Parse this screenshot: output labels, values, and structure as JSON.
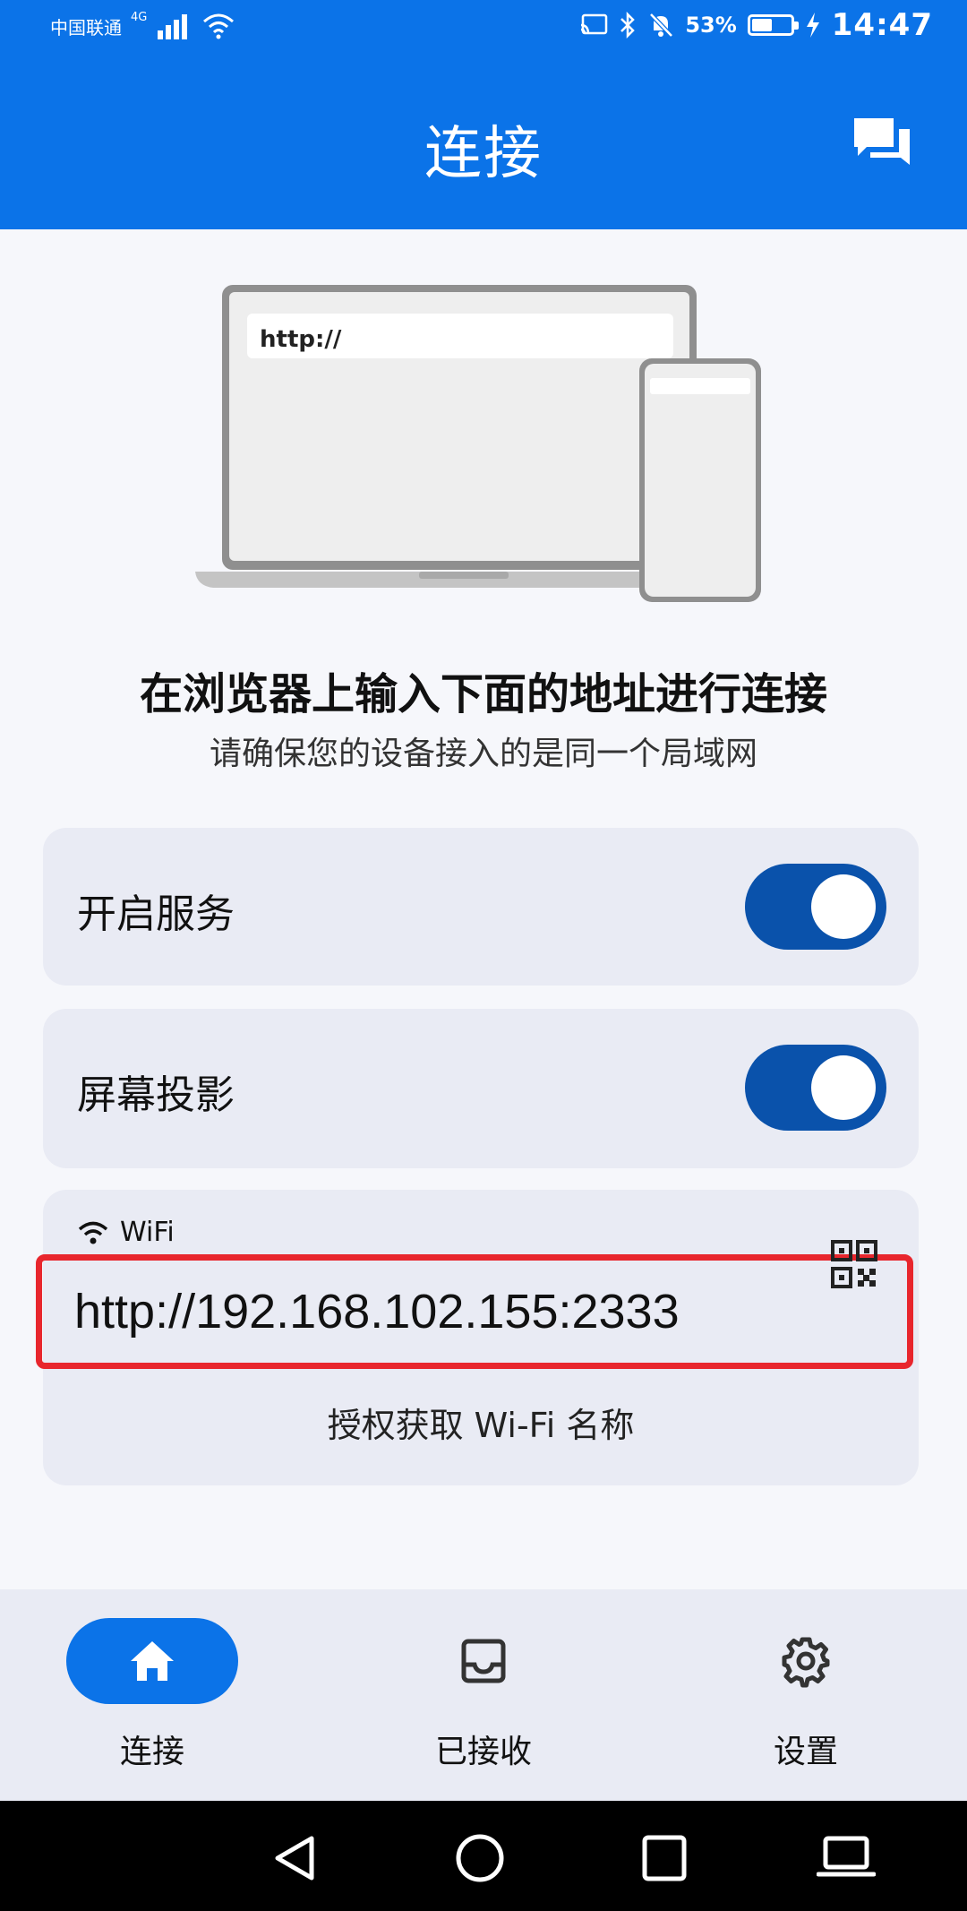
{
  "status_bar": {
    "carrier": "中国联通",
    "network": "4G",
    "battery_percent": "53%",
    "battery_level": 0.53,
    "time": "14:47"
  },
  "header": {
    "title": "连接",
    "action_icon": "chat-icon"
  },
  "illustration": {
    "url_text": "http://"
  },
  "instructions": {
    "headline": "在浏览器上输入下面的地址进行连接",
    "subline": "请确保您的设备接入的是同一个局域网"
  },
  "settings": {
    "service": {
      "label": "开启服务",
      "enabled": true
    },
    "screen_projection": {
      "label": "屏幕投影",
      "enabled": true
    }
  },
  "address_card": {
    "network_label": "WiFi",
    "address": "http://192.168.102.155:2333",
    "qr_icon": "qr-code-icon",
    "authorize_label": "授权获取 Wi-Fi 名称"
  },
  "bottom_nav": {
    "items": [
      {
        "label": "连接",
        "icon": "home-icon",
        "active": true
      },
      {
        "label": "已接收",
        "icon": "inbox-icon",
        "active": false
      },
      {
        "label": "设置",
        "icon": "gear-icon",
        "active": false
      }
    ]
  },
  "colors": {
    "primary": "#0b73e8",
    "toggle_on": "#0a52ab",
    "card_bg": "#e9ebf4",
    "highlight": "#e8262d"
  }
}
